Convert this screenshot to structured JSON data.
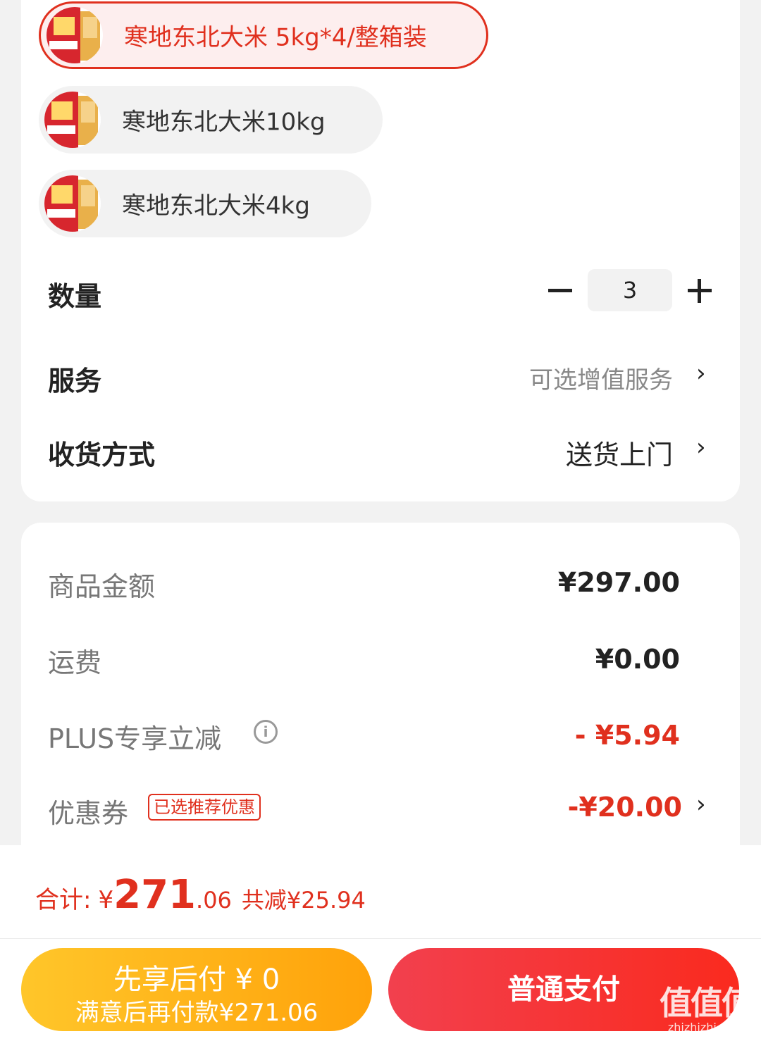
{
  "specs": [
    {
      "label": "寒地东北大米 5kg*4/整箱装",
      "selected": true
    },
    {
      "label": "寒地东北大米10kg",
      "selected": false
    },
    {
      "label": "寒地东北大米4kg",
      "selected": false
    }
  ],
  "quantity": {
    "label": "数量",
    "value": "3"
  },
  "service": {
    "label": "服务",
    "value": "可选增值服务",
    "chevron": "›"
  },
  "delivery": {
    "label": "收货方式",
    "value": "送货上门",
    "chevron": "›"
  },
  "price": {
    "goods_label": "商品金额",
    "goods_value": "¥297.00",
    "shipping_label": "运费",
    "shipping_value": "¥0.00",
    "plus_label": "PLUS专享立减",
    "plus_value": "- ¥5.94",
    "coupon_label": "优惠券",
    "coupon_badge": "已选推荐优惠",
    "coupon_value": "-¥20.00",
    "coupon_chevron": "›"
  },
  "total": {
    "label": "合计:",
    "currency": "¥",
    "integer": "271",
    "decimal": ".06",
    "savings": "共减¥25.94"
  },
  "buttons": {
    "pay_later_line1": "先享后付 ¥ 0",
    "pay_later_line2": "满意后再付款¥271.06",
    "pay_normal": "普通支付"
  },
  "watermark": {
    "line1": "值值值",
    "line2": "zhizhizhi.com"
  },
  "colors": {
    "accent": "#e0301e",
    "pay_later": "#ffb319",
    "pay_normal": "#f5333f"
  }
}
